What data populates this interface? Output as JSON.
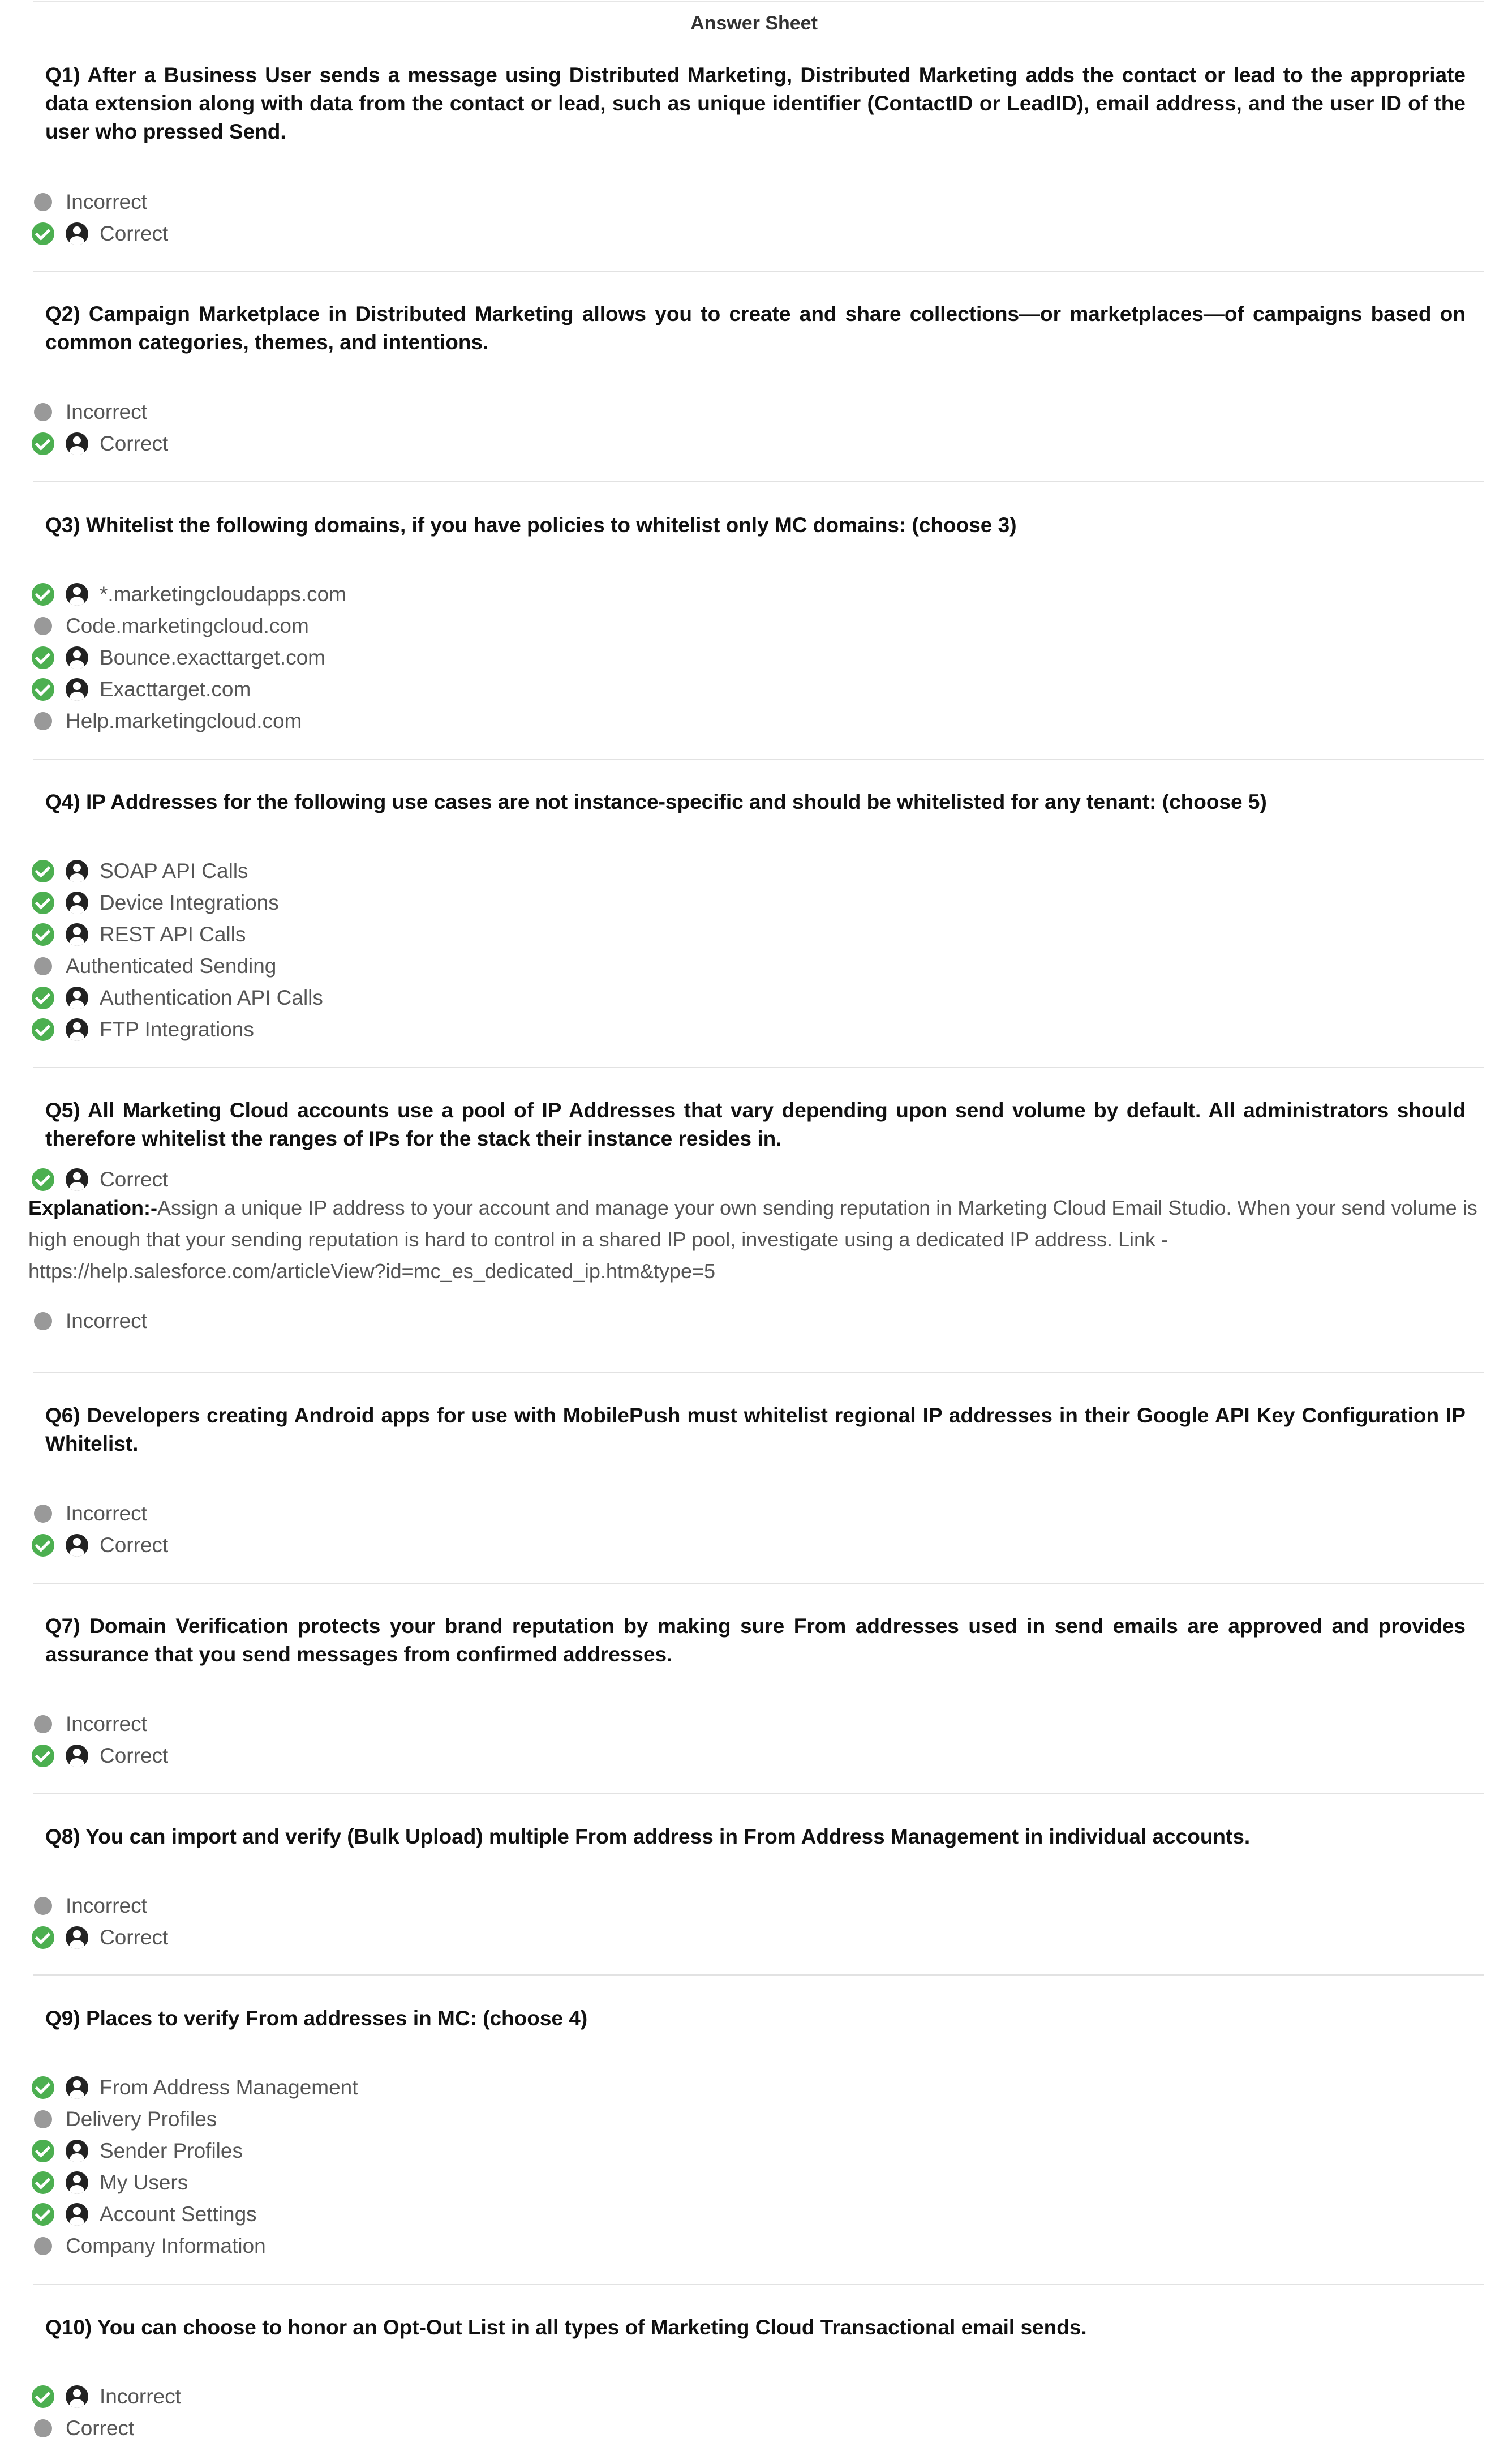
{
  "title": "Answer Sheet",
  "questions": [
    {
      "text": "Q1) After a Business User sends a message using Distributed Marketing, Distributed Marketing adds the contact or lead to the appropriate data extension along with data from the contact or lead, such as unique identifier (ContactID or LeadID), email address, and the user ID of the user who pressed Send.",
      "options": [
        {
          "label": "Incorrect",
          "correct": false,
          "selected": false
        },
        {
          "label": "Correct",
          "correct": true,
          "selected": true
        }
      ]
    },
    {
      "text": "Q2) Campaign Marketplace in Distributed Marketing allows you to create and share collections—or marketplaces—of campaigns based on common categories, themes, and intentions.",
      "options": [
        {
          "label": "Incorrect",
          "correct": false,
          "selected": false
        },
        {
          "label": "Correct",
          "correct": true,
          "selected": true
        }
      ]
    },
    {
      "text": "Q3) Whitelist the following domains, if you have policies to whitelist only MC domains: (choose 3)",
      "options": [
        {
          "label": "*.marketingcloudapps.com",
          "correct": true,
          "selected": true
        },
        {
          "label": "Code.marketingcloud.com",
          "correct": false,
          "selected": false
        },
        {
          "label": "Bounce.exacttarget.com",
          "correct": true,
          "selected": true
        },
        {
          "label": "Exacttarget.com",
          "correct": true,
          "selected": true
        },
        {
          "label": "Help.marketingcloud.com",
          "correct": false,
          "selected": false
        }
      ]
    },
    {
      "text": "Q4) IP Addresses for the following use cases are not instance-specific and should be whitelisted for any tenant: (choose 5)",
      "options": [
        {
          "label": "SOAP API Calls",
          "correct": true,
          "selected": true
        },
        {
          "label": "Device Integrations",
          "correct": true,
          "selected": true
        },
        {
          "label": "REST API Calls",
          "correct": true,
          "selected": true
        },
        {
          "label": "Authenticated Sending",
          "correct": false,
          "selected": false
        },
        {
          "label": "Authentication API Calls",
          "correct": true,
          "selected": true
        },
        {
          "label": "FTP Integrations",
          "correct": true,
          "selected": true
        }
      ]
    },
    {
      "text": "Q5) All Marketing Cloud accounts use a pool of IP Addresses that vary depending upon send volume by default. All administrators should therefore whitelist the ranges of IPs for the stack their instance resides in.",
      "options": [
        {
          "label": "Correct",
          "correct": true,
          "selected": true
        },
        {
          "label": "Incorrect",
          "correct": false,
          "selected": false
        }
      ],
      "explanation_label": "Explanation:-",
      "explanation_text": "Assign a unique IP address to your account and manage your own sending reputation in Marketing Cloud Email Studio. When your send volume is high enough that your sending reputation is hard to control in a shared IP pool, investigate using a dedicated IP address. Link - https://help.salesforce.com/articleView?id=mc_es_dedicated_ip.htm&type=5"
    },
    {
      "text": "Q6) Developers creating Android apps for use with MobilePush must whitelist regional IP addresses in their Google API Key Configuration IP Whitelist.",
      "options": [
        {
          "label": "Incorrect",
          "correct": false,
          "selected": false
        },
        {
          "label": "Correct",
          "correct": true,
          "selected": true
        }
      ]
    },
    {
      "text": "Q7) Domain Verification protects your brand reputation by making sure From addresses used in send emails are approved and provides assurance that you send messages from confirmed addresses.",
      "options": [
        {
          "label": "Incorrect",
          "correct": false,
          "selected": false
        },
        {
          "label": "Correct",
          "correct": true,
          "selected": true
        }
      ]
    },
    {
      "text": "Q8) You can import and verify (Bulk Upload) multiple From address in From Address Management in individual accounts.",
      "options": [
        {
          "label": "Incorrect",
          "correct": false,
          "selected": false
        },
        {
          "label": "Correct",
          "correct": true,
          "selected": true
        }
      ]
    },
    {
      "text": "Q9) Places to verify From addresses in MC: (choose 4)",
      "options": [
        {
          "label": "From Address Management",
          "correct": true,
          "selected": true
        },
        {
          "label": "Delivery Profiles",
          "correct": false,
          "selected": false
        },
        {
          "label": "Sender Profiles",
          "correct": true,
          "selected": true
        },
        {
          "label": "My Users",
          "correct": true,
          "selected": true
        },
        {
          "label": "Account Settings",
          "correct": true,
          "selected": true
        },
        {
          "label": "Company Information",
          "correct": false,
          "selected": false
        }
      ]
    },
    {
      "text": "Q10) You can choose to honor an Opt-Out List in all types of Marketing Cloud Transactional email sends.",
      "options": [
        {
          "label": "Incorrect",
          "correct": true,
          "selected": true
        },
        {
          "label": "Correct",
          "correct": false,
          "selected": false
        }
      ]
    }
  ]
}
